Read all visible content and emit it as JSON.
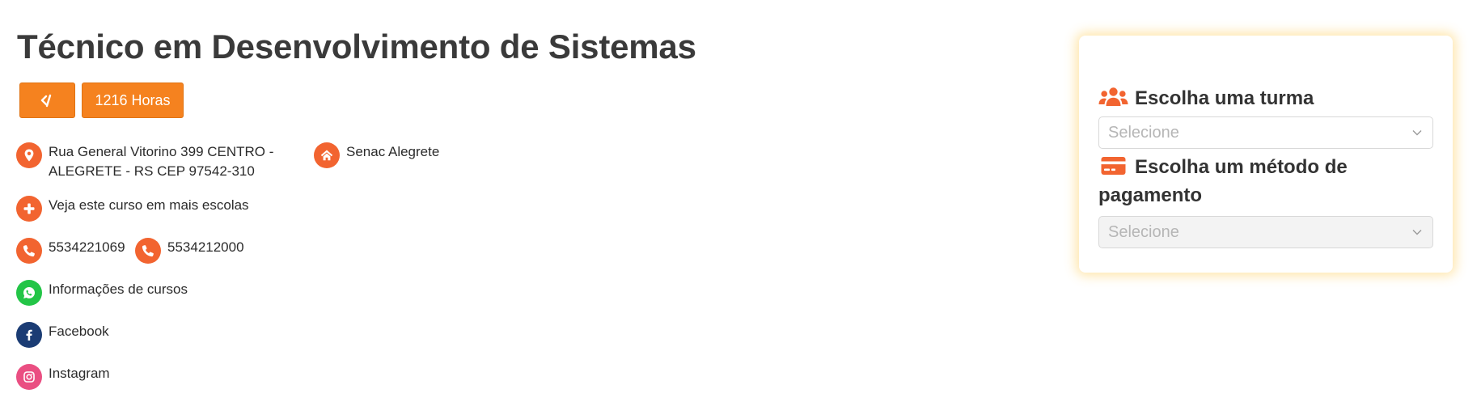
{
  "course": {
    "title": "Técnico em Desenvolvimento de Sistemas",
    "hours_label": "1216 Horas",
    "code_icon": "code-icon"
  },
  "contact": {
    "address": "Rua General Vitorino 399 CENTRO - ALEGRETE - RS CEP 97542-310",
    "school": "Senac Alegrete",
    "more_schools": "Veja este curso em mais escolas",
    "phone_1": "5534221069",
    "phone_2": "5534212000",
    "whatsapp": "Informações de cursos",
    "facebook": "Facebook",
    "instagram": "Instagram"
  },
  "enrollment": {
    "class_heading": "Escolha uma turma",
    "class_placeholder": "Selecione",
    "payment_heading_line1": "Escolha um método de",
    "payment_heading_line2": "pagamento",
    "payment_placeholder": "Selecione"
  },
  "colors": {
    "accent_orange": "#f5821f",
    "icon_orange": "#f26430",
    "whatsapp_green": "#23c547",
    "facebook_navy": "#1b3c74",
    "instagram_pink": "#ea4f82"
  }
}
